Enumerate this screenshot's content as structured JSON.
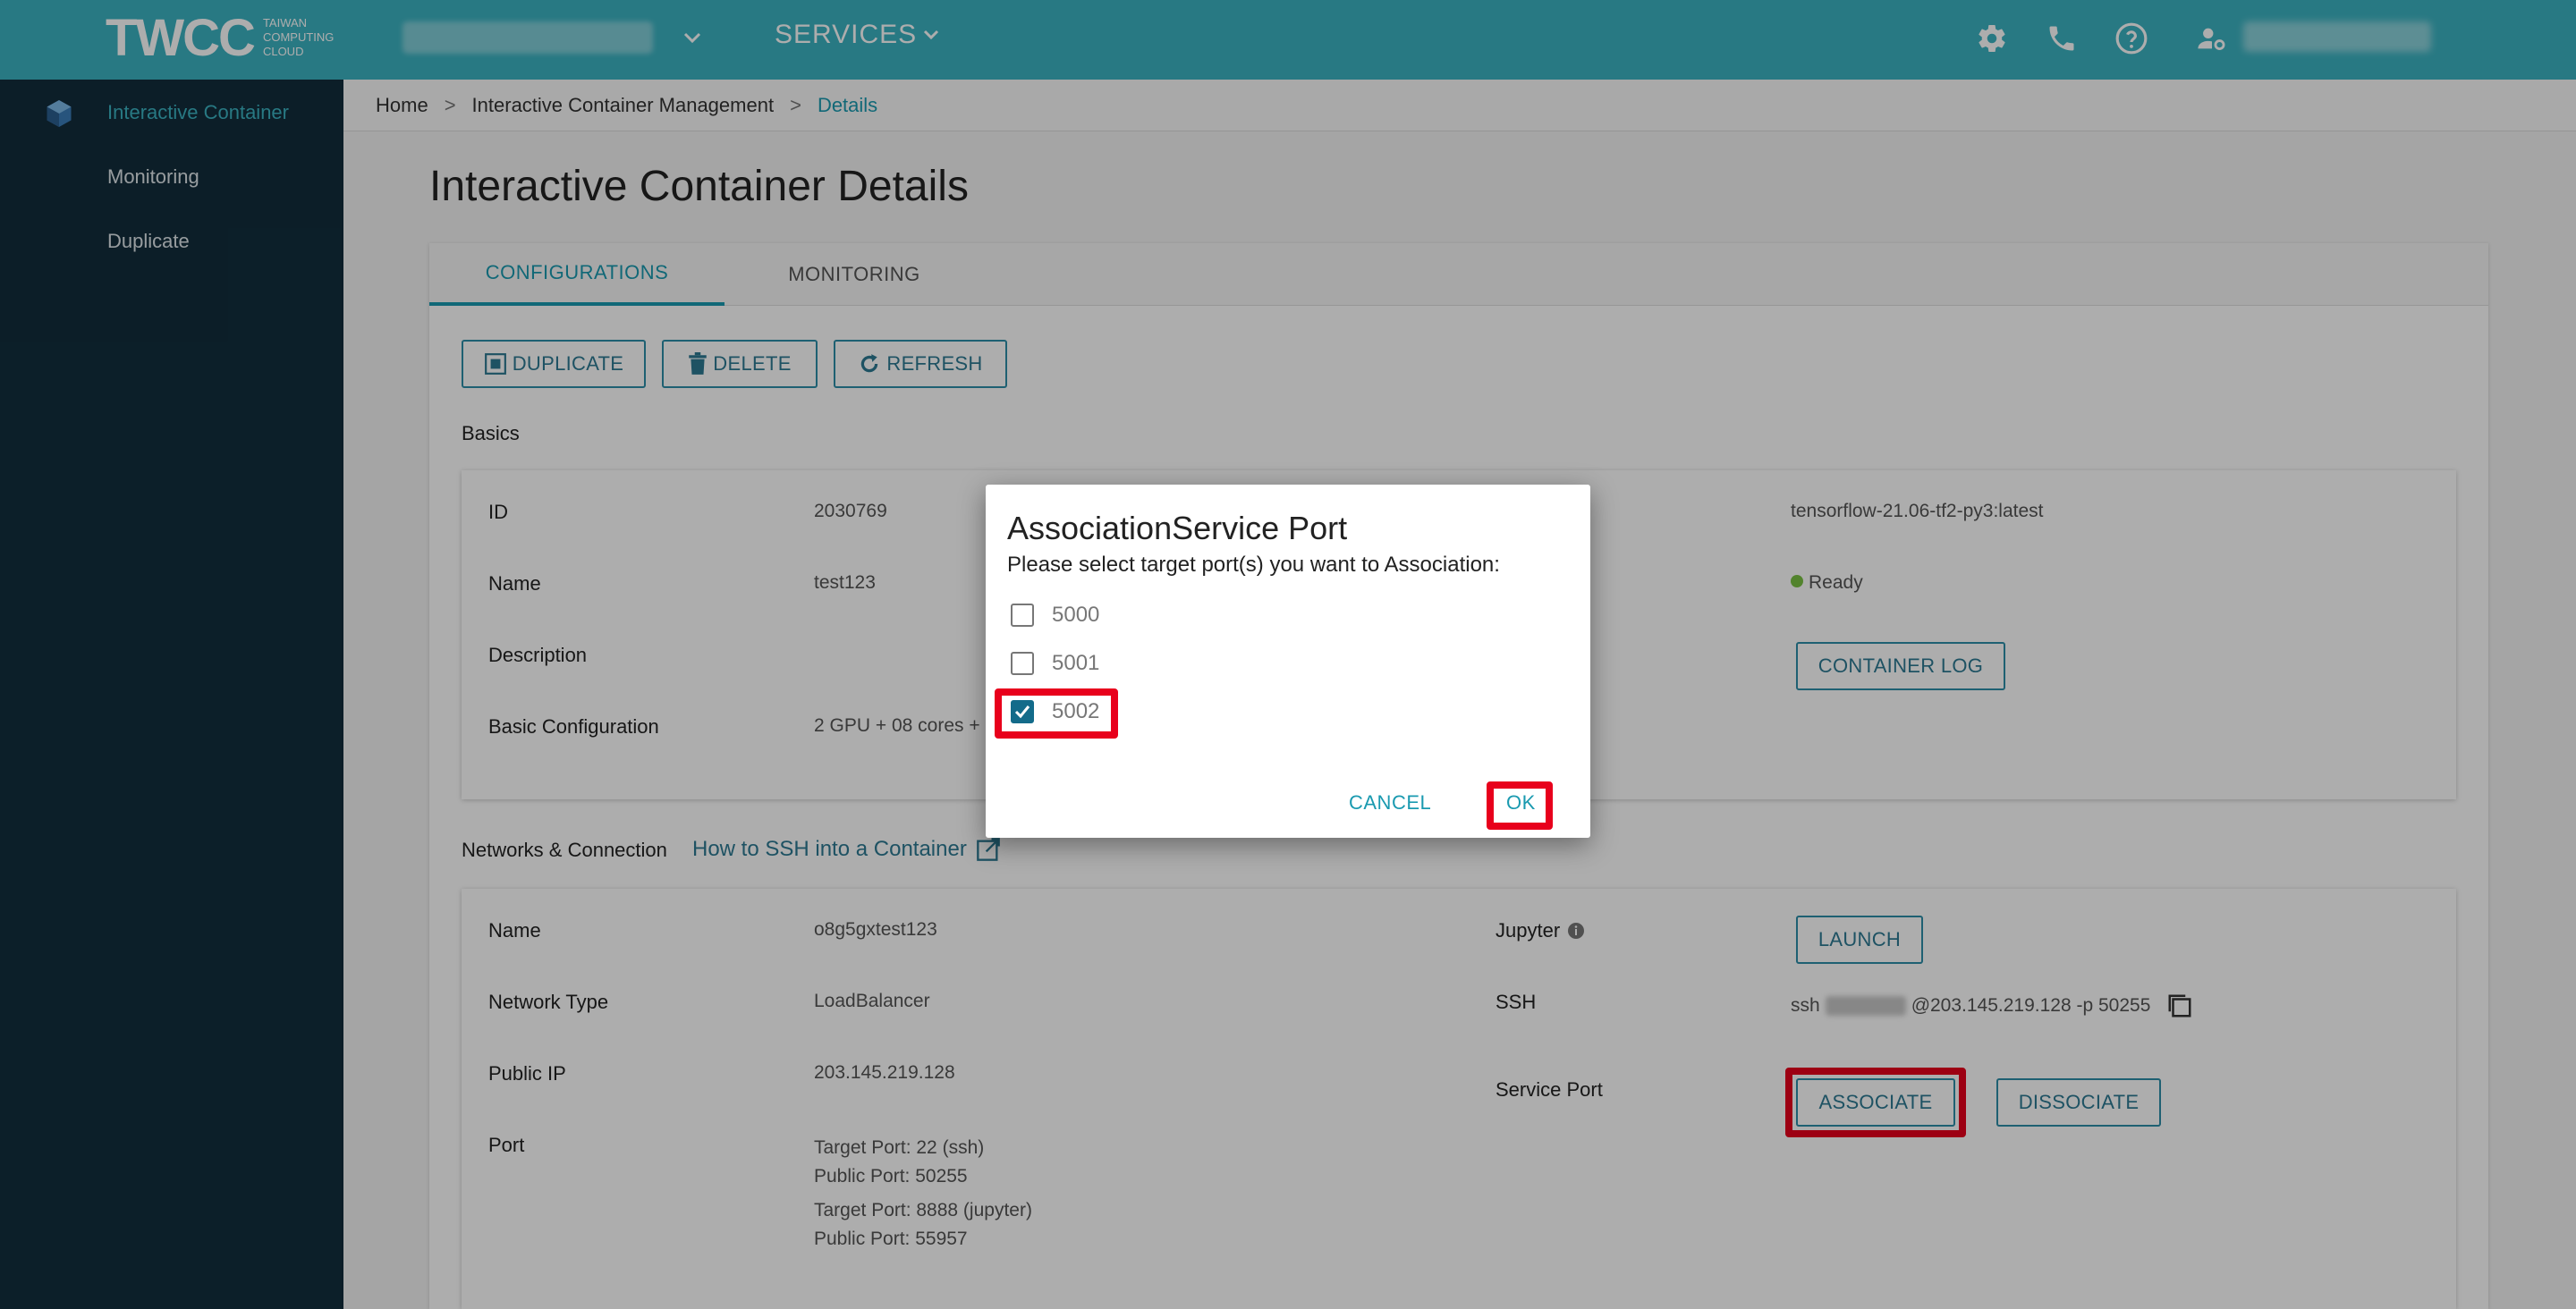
{
  "topbar": {
    "logo": "TWCC",
    "logo_sub": [
      "TAIWAN",
      "COMPUTING",
      "CLOUD"
    ],
    "services_label": "SERVICES"
  },
  "sidebar": {
    "items": [
      {
        "label": "Interactive Container",
        "active": true
      },
      {
        "label": "Monitoring",
        "active": false
      },
      {
        "label": "Duplicate",
        "active": false
      }
    ]
  },
  "breadcrumb": {
    "items": [
      "Home",
      "Interactive Container Management",
      "Details"
    ],
    "separator": ">"
  },
  "page": {
    "title": "Interactive Container Details",
    "tabs": [
      {
        "label": "CONFIGURATIONS",
        "active": true
      },
      {
        "label": "MONITORING",
        "active": false
      }
    ],
    "actions": {
      "duplicate": "DUPLICATE",
      "delete": "DELETE",
      "refresh": "REFRESH"
    },
    "basics": {
      "heading": "Basics",
      "id_label": "ID",
      "id_value": "2030769",
      "name_label": "Name",
      "name_value": "test123",
      "description_label": "Description",
      "basic_config_label": "Basic Configuration",
      "basic_config_value": "2 GPU + 08 cores +",
      "image_value": "tensorflow-21.06-tf2-py3:latest",
      "status_value": "Ready",
      "container_log_label": "CONTAINER LOG"
    },
    "network": {
      "heading": "Networks & Connection",
      "ssh_link": "How to SSH into a Container",
      "name_label": "Name",
      "name_value": "o8g5gxtest123",
      "network_type_label": "Network Type",
      "network_type_value": "LoadBalancer",
      "public_ip_label": "Public IP",
      "public_ip_value": "203.145.219.128",
      "port_label": "Port",
      "ports": [
        {
          "target": "Target Port: 22 (ssh)",
          "public": "Public Port: 50255"
        },
        {
          "target": "Target Port: 8888 (jupyter)",
          "public": "Public Port: 55957"
        }
      ],
      "jupyter_label": "Jupyter",
      "launch_label": "LAUNCH",
      "ssh_label": "SSH",
      "ssh_prefix": "ssh",
      "ssh_suffix": "@203.145.219.128 -p 50255",
      "service_port_label": "Service Port",
      "associate_label": "ASSOCIATE",
      "dissociate_label": "DISSOCIATE"
    }
  },
  "dialog": {
    "title": "AssociationService Port",
    "message": "Please select target port(s) you want to Association:",
    "options": [
      {
        "port": "5000",
        "checked": false
      },
      {
        "port": "5001",
        "checked": false
      },
      {
        "port": "5002",
        "checked": true
      }
    ],
    "cancel_label": "CANCEL",
    "ok_label": "OK"
  },
  "colors": {
    "topbar": "#3cb3c2",
    "sidebar": "#122d3c",
    "accent": "#1a9ab0",
    "highlight": "#e8001c"
  }
}
